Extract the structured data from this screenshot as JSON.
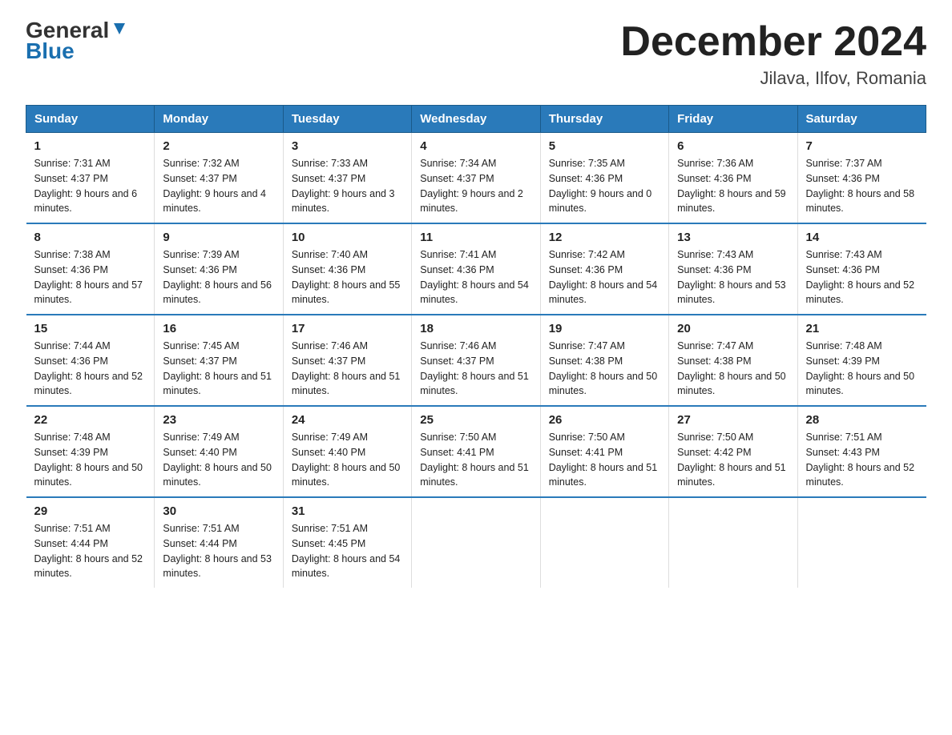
{
  "header": {
    "logo_line1": "General",
    "logo_line2": "Blue",
    "title": "December 2024",
    "subtitle": "Jilava, Ilfov, Romania"
  },
  "days_header": [
    "Sunday",
    "Monday",
    "Tuesday",
    "Wednesday",
    "Thursday",
    "Friday",
    "Saturday"
  ],
  "weeks": [
    [
      {
        "num": "1",
        "sunrise": "7:31 AM",
        "sunset": "4:37 PM",
        "daylight": "9 hours and 6 minutes."
      },
      {
        "num": "2",
        "sunrise": "7:32 AM",
        "sunset": "4:37 PM",
        "daylight": "9 hours and 4 minutes."
      },
      {
        "num": "3",
        "sunrise": "7:33 AM",
        "sunset": "4:37 PM",
        "daylight": "9 hours and 3 minutes."
      },
      {
        "num": "4",
        "sunrise": "7:34 AM",
        "sunset": "4:37 PM",
        "daylight": "9 hours and 2 minutes."
      },
      {
        "num": "5",
        "sunrise": "7:35 AM",
        "sunset": "4:36 PM",
        "daylight": "9 hours and 0 minutes."
      },
      {
        "num": "6",
        "sunrise": "7:36 AM",
        "sunset": "4:36 PM",
        "daylight": "8 hours and 59 minutes."
      },
      {
        "num": "7",
        "sunrise": "7:37 AM",
        "sunset": "4:36 PM",
        "daylight": "8 hours and 58 minutes."
      }
    ],
    [
      {
        "num": "8",
        "sunrise": "7:38 AM",
        "sunset": "4:36 PM",
        "daylight": "8 hours and 57 minutes."
      },
      {
        "num": "9",
        "sunrise": "7:39 AM",
        "sunset": "4:36 PM",
        "daylight": "8 hours and 56 minutes."
      },
      {
        "num": "10",
        "sunrise": "7:40 AM",
        "sunset": "4:36 PM",
        "daylight": "8 hours and 55 minutes."
      },
      {
        "num": "11",
        "sunrise": "7:41 AM",
        "sunset": "4:36 PM",
        "daylight": "8 hours and 54 minutes."
      },
      {
        "num": "12",
        "sunrise": "7:42 AM",
        "sunset": "4:36 PM",
        "daylight": "8 hours and 54 minutes."
      },
      {
        "num": "13",
        "sunrise": "7:43 AM",
        "sunset": "4:36 PM",
        "daylight": "8 hours and 53 minutes."
      },
      {
        "num": "14",
        "sunrise": "7:43 AM",
        "sunset": "4:36 PM",
        "daylight": "8 hours and 52 minutes."
      }
    ],
    [
      {
        "num": "15",
        "sunrise": "7:44 AM",
        "sunset": "4:36 PM",
        "daylight": "8 hours and 52 minutes."
      },
      {
        "num": "16",
        "sunrise": "7:45 AM",
        "sunset": "4:37 PM",
        "daylight": "8 hours and 51 minutes."
      },
      {
        "num": "17",
        "sunrise": "7:46 AM",
        "sunset": "4:37 PM",
        "daylight": "8 hours and 51 minutes."
      },
      {
        "num": "18",
        "sunrise": "7:46 AM",
        "sunset": "4:37 PM",
        "daylight": "8 hours and 51 minutes."
      },
      {
        "num": "19",
        "sunrise": "7:47 AM",
        "sunset": "4:38 PM",
        "daylight": "8 hours and 50 minutes."
      },
      {
        "num": "20",
        "sunrise": "7:47 AM",
        "sunset": "4:38 PM",
        "daylight": "8 hours and 50 minutes."
      },
      {
        "num": "21",
        "sunrise": "7:48 AM",
        "sunset": "4:39 PM",
        "daylight": "8 hours and 50 minutes."
      }
    ],
    [
      {
        "num": "22",
        "sunrise": "7:48 AM",
        "sunset": "4:39 PM",
        "daylight": "8 hours and 50 minutes."
      },
      {
        "num": "23",
        "sunrise": "7:49 AM",
        "sunset": "4:40 PM",
        "daylight": "8 hours and 50 minutes."
      },
      {
        "num": "24",
        "sunrise": "7:49 AM",
        "sunset": "4:40 PM",
        "daylight": "8 hours and 50 minutes."
      },
      {
        "num": "25",
        "sunrise": "7:50 AM",
        "sunset": "4:41 PM",
        "daylight": "8 hours and 51 minutes."
      },
      {
        "num": "26",
        "sunrise": "7:50 AM",
        "sunset": "4:41 PM",
        "daylight": "8 hours and 51 minutes."
      },
      {
        "num": "27",
        "sunrise": "7:50 AM",
        "sunset": "4:42 PM",
        "daylight": "8 hours and 51 minutes."
      },
      {
        "num": "28",
        "sunrise": "7:51 AM",
        "sunset": "4:43 PM",
        "daylight": "8 hours and 52 minutes."
      }
    ],
    [
      {
        "num": "29",
        "sunrise": "7:51 AM",
        "sunset": "4:44 PM",
        "daylight": "8 hours and 52 minutes."
      },
      {
        "num": "30",
        "sunrise": "7:51 AM",
        "sunset": "4:44 PM",
        "daylight": "8 hours and 53 minutes."
      },
      {
        "num": "31",
        "sunrise": "7:51 AM",
        "sunset": "4:45 PM",
        "daylight": "8 hours and 54 minutes."
      },
      null,
      null,
      null,
      null
    ]
  ],
  "labels": {
    "sunrise": "Sunrise:",
    "sunset": "Sunset:",
    "daylight": "Daylight:"
  }
}
